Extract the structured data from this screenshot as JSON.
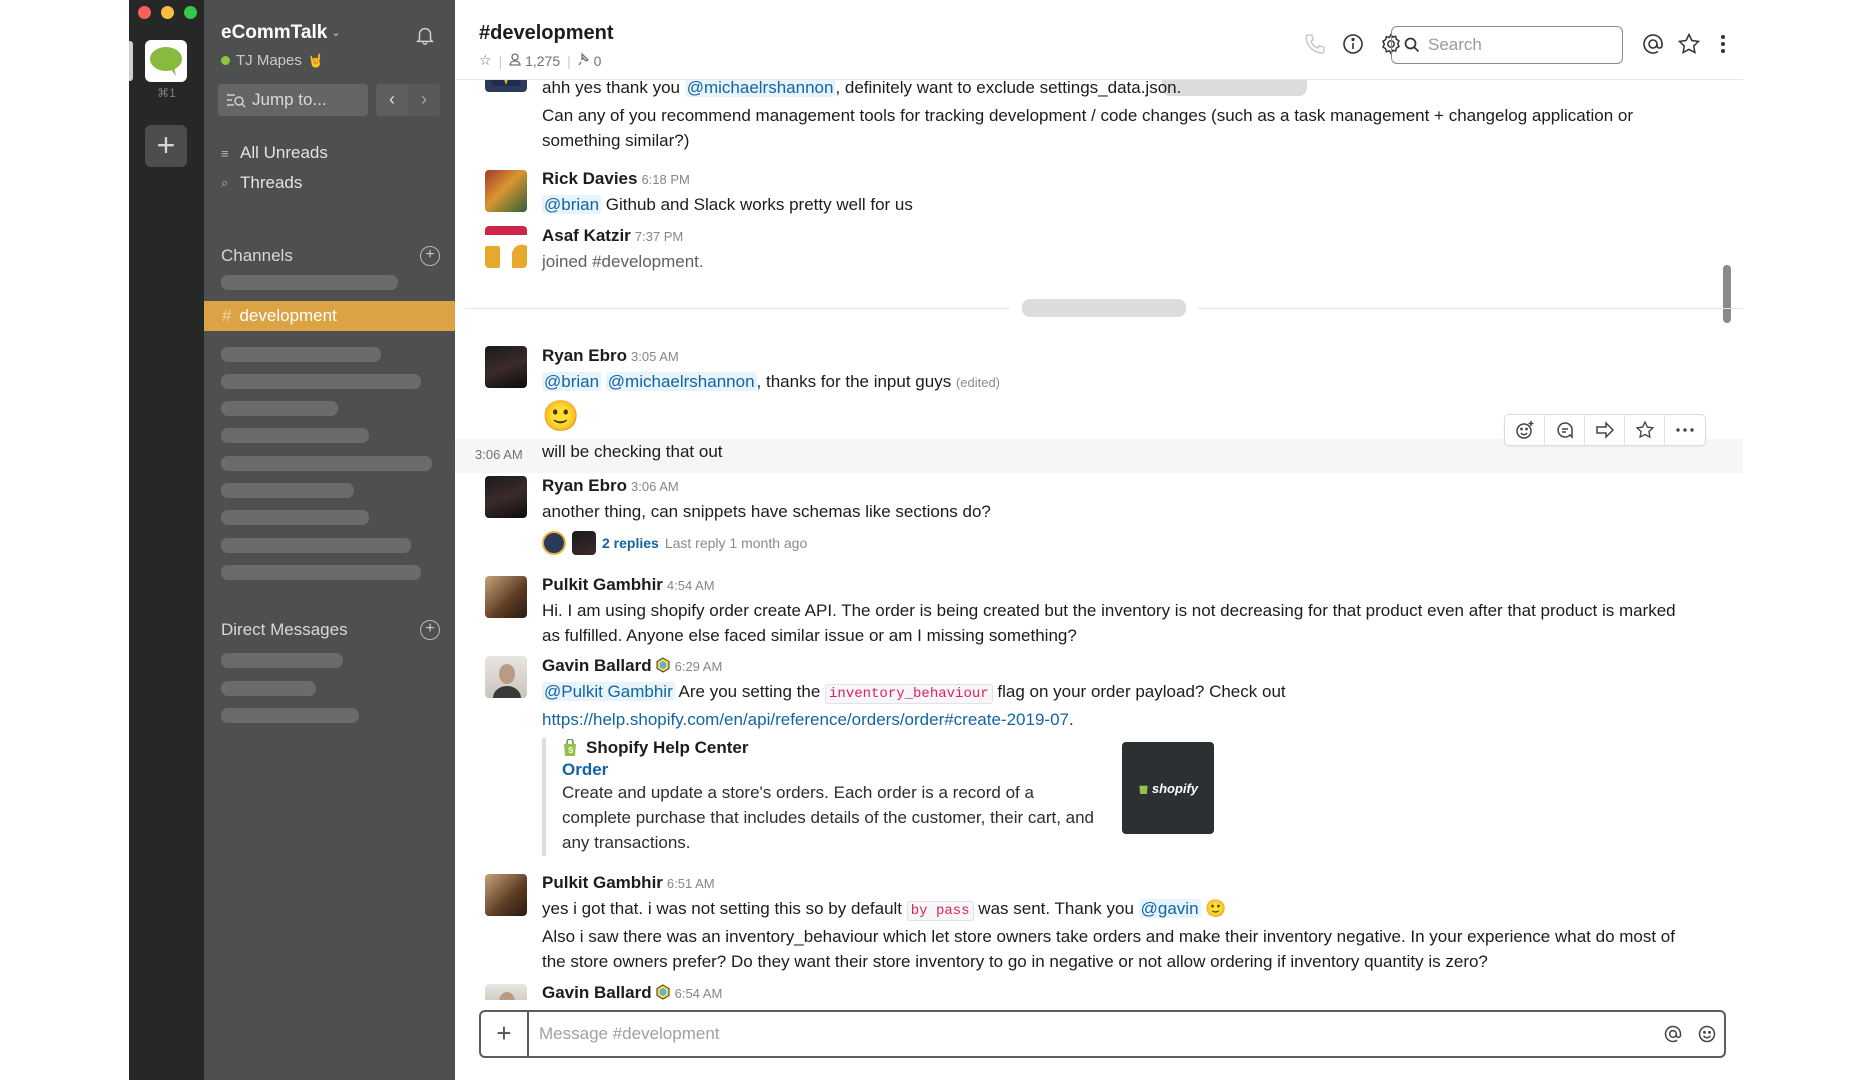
{
  "window": {
    "team_shortcut": "⌘1",
    "add_team_label": "+"
  },
  "sidebar": {
    "workspace_name": "eCommTalk",
    "user_name": "TJ Mapes",
    "user_status_emoji": "🤘",
    "jump_to_label": "Jump to...",
    "back_label": "‹",
    "forward_label": "›",
    "nav_items": [
      {
        "label": "All Unreads",
        "icon": "unreads-icon"
      },
      {
        "label": "Threads",
        "icon": "threads-icon"
      }
    ],
    "channels_header": "Channels",
    "active_channel": "development",
    "active_channel_prefix": "#",
    "dm_header": "Direct Messages"
  },
  "header": {
    "channel_title": "#development",
    "member_count": "1,275",
    "pinned_count": "0",
    "search_placeholder": "Search"
  },
  "messages": [
    {
      "author": "",
      "lines": [
        {
          "pre": "ahh yes thank you ",
          "mention": "@michaelrshannon",
          "post": ", definitely want to exclude settings_data.json."
        },
        {
          "text": "Can any of you recommend management tools for tracking development / code changes (such as a task management + changelog application or something similar?)"
        }
      ]
    },
    {
      "author": "Rick Davies",
      "time": "6:18 PM",
      "mention": "@brian",
      "text": " Github and Slack works pretty well for us"
    },
    {
      "author": "Asaf Katzir",
      "time": "7:37 PM",
      "text": "joined #development."
    },
    {
      "author": "Ryan Ebro",
      "time": "3:05 AM",
      "mention1": "@brian",
      "mention2": "@michaelrshannon",
      "text": ", thanks for the input guys",
      "edited": "(edited)",
      "emoji": "🙂"
    },
    {
      "time": "3:06 AM",
      "text": "will be checking that out",
      "hovered": true
    },
    {
      "author": "Ryan Ebro",
      "time": "3:06 AM",
      "text": "another thing, can snippets have schemas like sections do?",
      "thread_replies": "2 replies",
      "thread_last": "Last reply 1 month ago"
    },
    {
      "author": "Pulkit Gambhir",
      "time": "4:54 AM",
      "text": "Hi. I am using shopify order create API. The order is being created but the inventory is not decreasing for that product even after that product is marked as fulfilled. Anyone else faced similar issue or am I missing something?"
    },
    {
      "author": "Gavin Ballard",
      "time": "6:29 AM",
      "mention": "@Pulkit Gambhir",
      "pre": " Are you setting the ",
      "code": "inventory_behaviour",
      "post": " flag on your order payload? Check out",
      "link": "https://help.shopify.com/en/api/reference/orders/order#create-2019-07",
      "link_suffix": ".",
      "attachment": {
        "source": "Shopify Help Center",
        "title": "Order",
        "body": "Create and update a store's orders. Each order is a record of a complete purchase that includes details of the customer, their cart, and any transactions.",
        "thumb_label": "shopify"
      }
    },
    {
      "author": "Pulkit Gambhir",
      "time": "6:51 AM",
      "pre": "yes i got that. i was not setting this so by default ",
      "code": "by pass",
      "mid": " was sent. Thank you ",
      "mention": "@gavin",
      "emoji": "🙂",
      "text2": "Also i saw there was an inventory_behaviour which let store owners take orders and make their inventory negative. In your experience what do most of the store owners prefer? Do they want their store inventory to go in negative or not allow ordering if inventory quantity is zero?"
    },
    {
      "author": "Gavin Ballard",
      "time": "6:54 AM"
    }
  ],
  "composer": {
    "placeholder": "Message #development",
    "plus_label": "+"
  },
  "colors": {
    "active_channel": "#dca345",
    "sidebar": "#4d504f",
    "team_bar": "#262827",
    "mention": "#1264a3",
    "code": "#e01e5a"
  }
}
